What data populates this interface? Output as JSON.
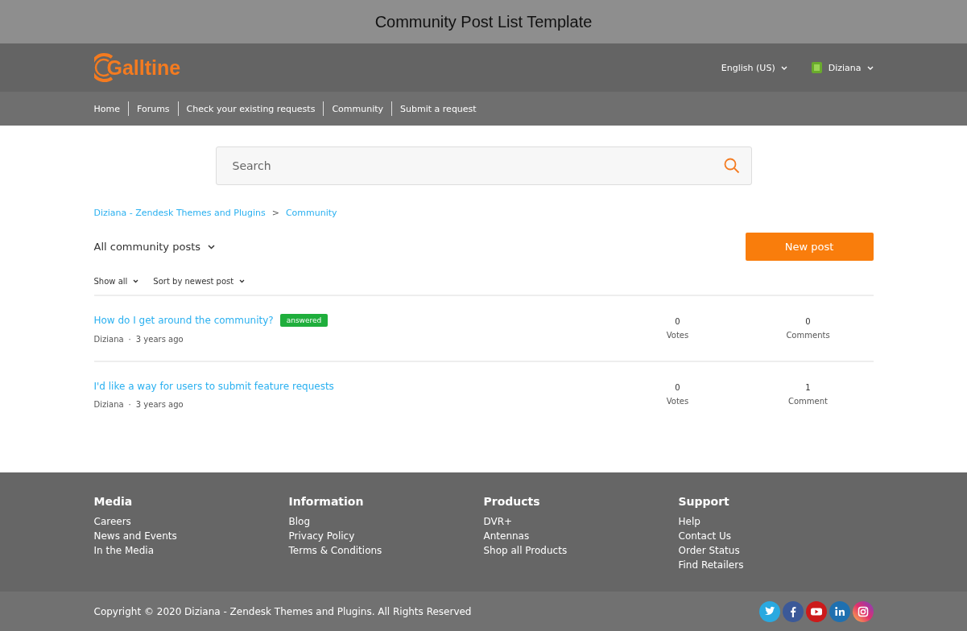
{
  "window": {
    "title": "Community Post List Template"
  },
  "header": {
    "logo": "Galltine",
    "language": "English (US)",
    "user": "Diziana"
  },
  "nav": [
    "Home",
    "Forums",
    "Check your existing requests",
    "Community",
    "Submit a request"
  ],
  "search": {
    "placeholder": "Search"
  },
  "breadcrumbs": [
    "Diziana - Zendesk Themes and Plugins",
    ">",
    "Community"
  ],
  "filter": "All community posts",
  "new_post_button": "New post",
  "sort": [
    "Show all",
    "Sort by newest post"
  ],
  "posts": [
    {
      "title": "How do I get around the community?",
      "badge": "answered",
      "author": "Diziana",
      "separator": "·",
      "time": "3 years ago",
      "votes": "0",
      "votes_label": "Votes",
      "comments": "0",
      "comments_label": "Comments"
    },
    {
      "title": "I'd like a way for users to submit feature requests",
      "author": "Diziana",
      "separator": "·",
      "time": "3 years ago",
      "votes": "0",
      "votes_label": "Votes",
      "comments": "1",
      "comments_label": "Comment"
    }
  ],
  "footer": {
    "columns": [
      {
        "heading": "Media",
        "links": [
          "Careers",
          "News and Events",
          "In the Media"
        ]
      },
      {
        "heading": "Information",
        "links": [
          "Blog",
          "Privacy Policy",
          "Terms & Conditions"
        ]
      },
      {
        "heading": "Products",
        "links": [
          "DVR+",
          "Antennas",
          "Shop all Products"
        ]
      },
      {
        "heading": "Support",
        "links": [
          "Help",
          "Contact Us",
          "Order Status",
          "Find Retailers"
        ]
      }
    ],
    "copyright": "Copyright © 2020 Diziana - Zendesk Themes and Plugins. All Rights Reserved"
  }
}
